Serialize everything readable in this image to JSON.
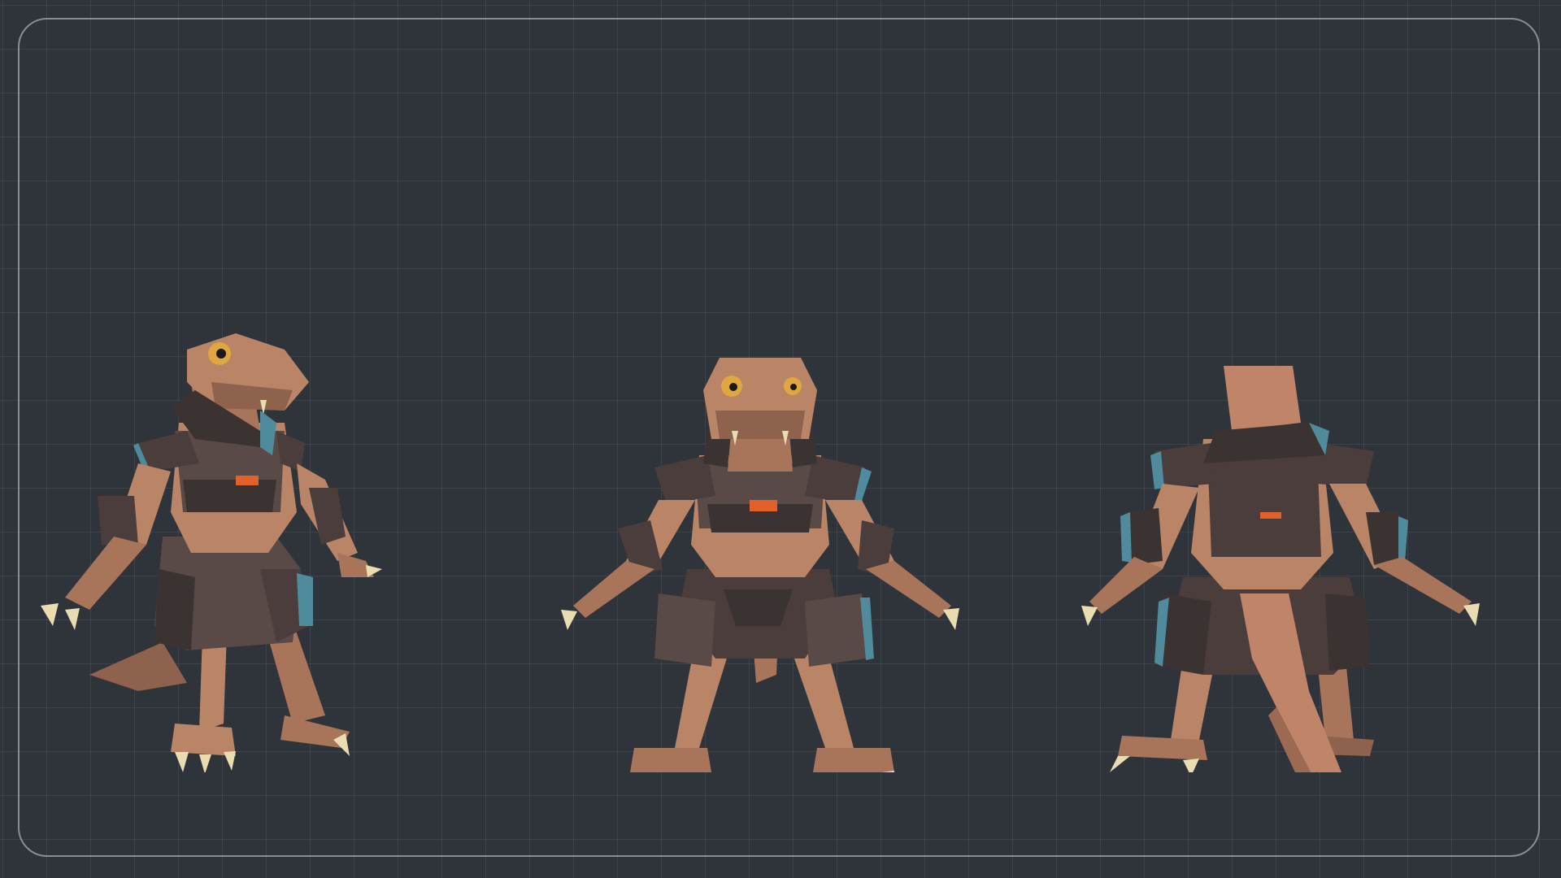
{
  "scene": {
    "views": [
      {
        "id": "three-quarter",
        "facing": "right"
      },
      {
        "id": "front",
        "facing": "viewer"
      },
      {
        "id": "back",
        "facing": "away"
      }
    ]
  },
  "palette": {
    "background": "#2f343b",
    "grid": "#444a52",
    "frame": "#c9ced5",
    "skin": "#b98566",
    "skin_shadow": "#8e624c",
    "armor": "#5a4a47",
    "armor_dark": "#3b3232",
    "armor_rim": "#4f8b9c",
    "accent": "#e2602a",
    "claw": "#e8dcb0",
    "eye": "#e0a640"
  }
}
